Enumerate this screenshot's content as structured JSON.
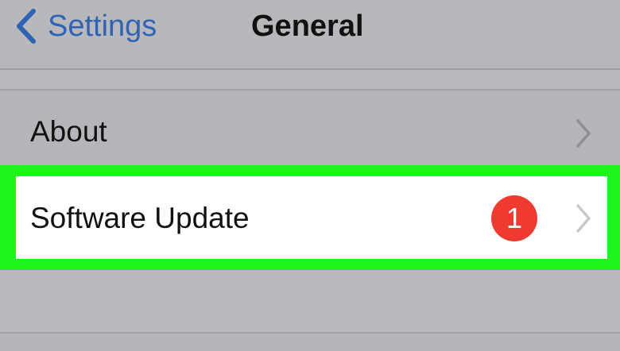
{
  "nav": {
    "back_label": "Settings",
    "back_icon": "chevron-left-icon",
    "title": "General"
  },
  "list": {
    "items": [
      {
        "label": "About",
        "icon": "chevron-right-icon"
      },
      {
        "label": "Software Update",
        "badge": "1",
        "icon": "chevron-right-icon",
        "highlighted": true
      }
    ]
  },
  "colors": {
    "accent": "#2f63b3",
    "badge": "#ef3a32",
    "highlight": "#1ff51c",
    "background": "#b9b9bd"
  }
}
